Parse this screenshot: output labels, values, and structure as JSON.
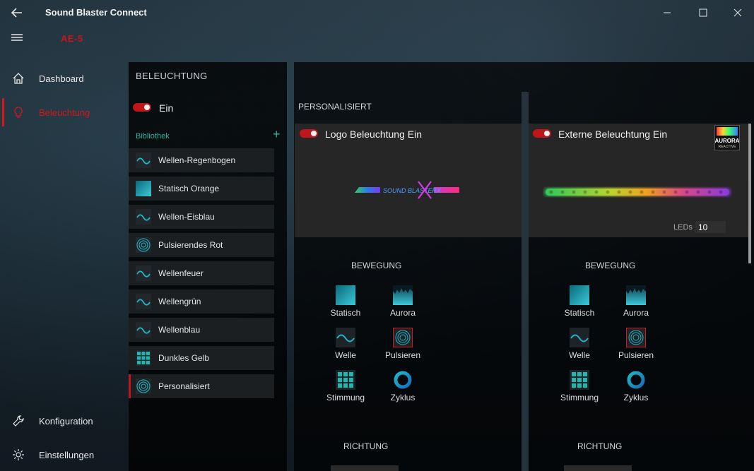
{
  "window": {
    "title": "Sound Blaster Connect",
    "device": "AE-5"
  },
  "nav": {
    "dashboard": "Dashboard",
    "beleuchtung": "Beleuchtung",
    "konfiguration": "Konfiguration",
    "einstellungen": "Einstellungen"
  },
  "library": {
    "header": "BELEUCHTUNG",
    "toggle_label": "Ein",
    "section": "Bibliothek",
    "items": [
      {
        "label": "Wellen-Regenbogen",
        "icon": "wave-icon"
      },
      {
        "label": "Statisch Orange",
        "icon": "static-icon"
      },
      {
        "label": "Wellen-Eisblau",
        "icon": "wave-icon"
      },
      {
        "label": "Pulsierendes Rot",
        "icon": "pulse-icon"
      },
      {
        "label": "Wellenfeuer",
        "icon": "wave-icon"
      },
      {
        "label": "Wellengrün",
        "icon": "wave-icon"
      },
      {
        "label": "Wellenblau",
        "icon": "wave-icon"
      },
      {
        "label": "Dunkles Gelb",
        "icon": "grid-icon"
      },
      {
        "label": "Personalisiert",
        "icon": "pulse-icon"
      }
    ]
  },
  "main": {
    "section": "PERSONALISIERT",
    "logo_card": {
      "title": "Logo Beleuchtung Ein",
      "bewegung": "BEWEGUNG",
      "richtung": "RICHTUNG",
      "moves": [
        "Statisch",
        "Aurora",
        "Welle",
        "Pulsieren",
        "Stimmung",
        "Zyklus"
      ]
    },
    "ext_card": {
      "title": "Externe Beleuchtung Ein",
      "bewegung": "BEWEGUNG",
      "richtung": "RICHTUNG",
      "leds_label": "LEDs",
      "leds_value": "10",
      "aurora_badge": "AURORA REACTIVE",
      "moves": [
        "Statisch",
        "Aurora",
        "Welle",
        "Pulsieren",
        "Stimmung",
        "Zyklus"
      ]
    },
    "logo_text": "SOUND BLASTERX"
  },
  "colors": {
    "accent_red": "#c0161b",
    "accent_teal": "#2ab39a"
  }
}
